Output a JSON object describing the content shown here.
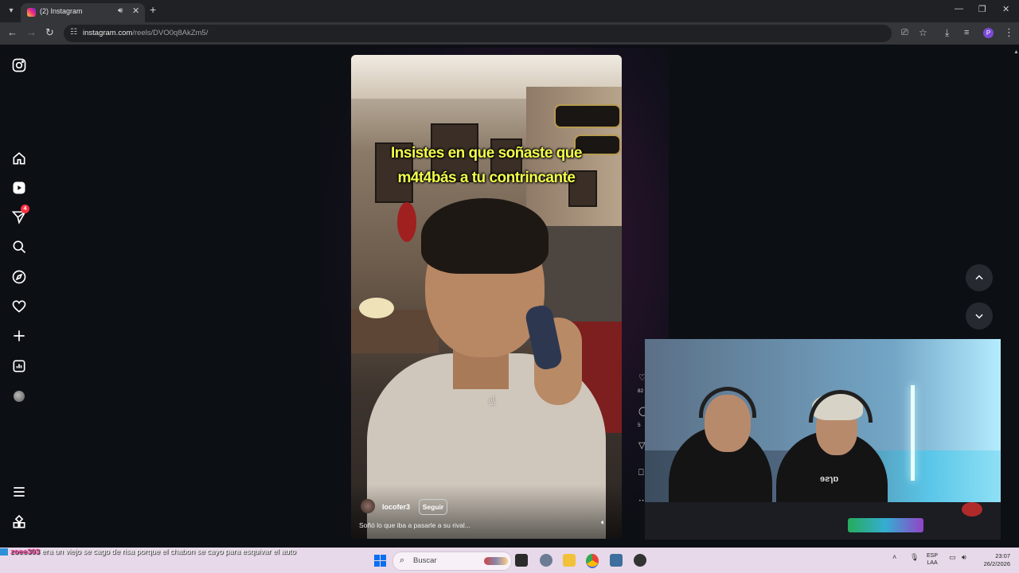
{
  "browser": {
    "tab_title": "(2) Instagram",
    "url_host": "instagram.com",
    "url_path": "/reels/DVO0q8AkZm5/",
    "profile_initial": "P"
  },
  "sidebar": {
    "items": [
      {
        "icon": "instagram-logo-icon"
      },
      {
        "icon": "home-icon"
      },
      {
        "icon": "reels-icon"
      },
      {
        "icon": "messages-icon",
        "badge": "4"
      },
      {
        "icon": "search-icon"
      },
      {
        "icon": "explore-icon"
      },
      {
        "icon": "heart-icon"
      },
      {
        "icon": "create-icon"
      },
      {
        "icon": "dashboard-icon"
      },
      {
        "icon": "profile-avatar"
      },
      {
        "icon": "menu-icon"
      },
      {
        "icon": "also-from-meta-icon"
      }
    ]
  },
  "reel": {
    "overlay_line1": "Insistes en que soñaste que",
    "overlay_line2": "m4t4bás a tu contrincante",
    "username": "locofer3",
    "follow_label": "Seguir",
    "caption": "Soñó lo que iba a pasarle a su rival...",
    "like_count": "82",
    "comment_count": "5"
  },
  "stream_overlay": {
    "shirt_text": "ɘƨɿɒ"
  },
  "chat": {
    "username": "zoee303",
    "message": "era un viejo se cago de risa porque el chabon se cayo para esquivar el auto"
  },
  "taskbar": {
    "search_placeholder": "Buscar",
    "lang_top": "ESP",
    "lang_bottom": "LAA",
    "time": "23:07",
    "date": "26/2/2026"
  },
  "colors": {
    "page_bg": "#0c0f14",
    "overlay_text": "#f4ff4a",
    "badge": "#ff3040",
    "chat_name": "#ff4aa6"
  }
}
